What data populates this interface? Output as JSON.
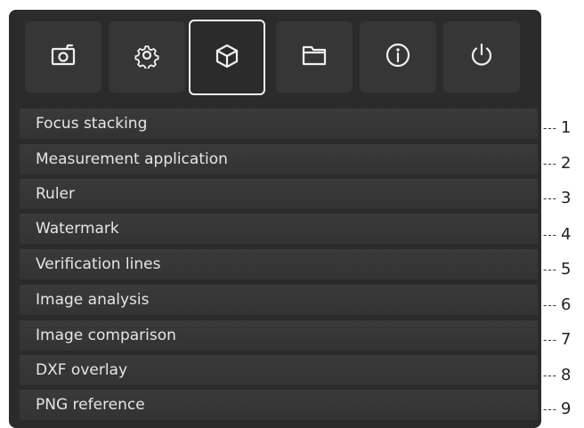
{
  "toolbar": {
    "buttons": [
      {
        "icon": "camera-icon",
        "active": false
      },
      {
        "icon": "gear-icon",
        "active": false
      },
      {
        "icon": "cube-icon",
        "active": true
      },
      {
        "icon": "folder-icon",
        "active": false
      },
      {
        "icon": "info-icon",
        "active": false
      },
      {
        "icon": "power-icon",
        "active": false
      }
    ]
  },
  "menu": {
    "items": [
      {
        "label": "Focus stacking"
      },
      {
        "label": "Measurement application"
      },
      {
        "label": "Ruler"
      },
      {
        "label": "Watermark"
      },
      {
        "label": "Verification lines"
      },
      {
        "label": "Image analysis"
      },
      {
        "label": "Image comparison"
      },
      {
        "label": "DXF overlay"
      },
      {
        "label": "PNG reference"
      }
    ]
  },
  "callouts": {
    "dash": "---",
    "numbers": [
      "1",
      "2",
      "3",
      "4",
      "5",
      "6",
      "7",
      "8",
      "9"
    ]
  }
}
